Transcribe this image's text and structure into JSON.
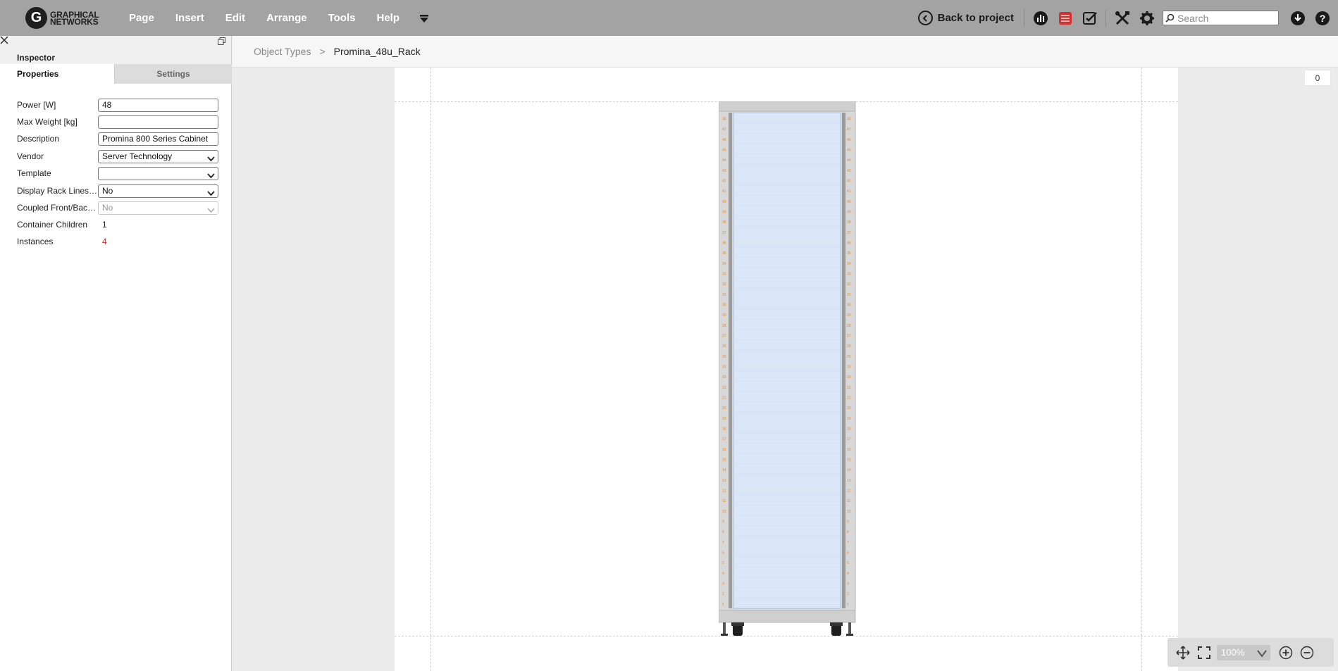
{
  "app": {
    "logo_mark": "G",
    "logo_line1": "GRAPHICAL",
    "logo_line2": "NETWORKS"
  },
  "menu": {
    "items": [
      "Page",
      "Insert",
      "Edit",
      "Arrange",
      "Tools",
      "Help"
    ]
  },
  "toolbar": {
    "back_label": "Back to project",
    "search_placeholder": "Search",
    "icons": [
      "dashboard-icon",
      "report-icon",
      "checklist-icon",
      "tools-icon",
      "settings-icon",
      "download-icon",
      "help-icon"
    ],
    "report_color": "#d32f2f"
  },
  "inspector": {
    "title": "Inspector",
    "tabs": {
      "properties": "Properties",
      "settings": "Settings"
    },
    "fields": {
      "power": {
        "label": "Power [W]",
        "value": "48"
      },
      "max_weight": {
        "label": "Max Weight [kg]",
        "value": ""
      },
      "description": {
        "label": "Description",
        "value": "Promina 800 Series Cabinet"
      },
      "vendor": {
        "label": "Vendor",
        "value": "Server Technology"
      },
      "template": {
        "label": "Template",
        "value": ""
      },
      "display_rack_lines": {
        "label": "Display Rack Lines i...",
        "value": "No"
      },
      "coupled": {
        "label": "Coupled Front/Back ...",
        "value": "No"
      },
      "container_children": {
        "label": "Container Children",
        "value": "1"
      },
      "instances": {
        "label": "Instances",
        "value": "4"
      }
    }
  },
  "breadcrumb": {
    "root": "Object Types",
    "separator": ">",
    "current": "Promina_48u_Rack"
  },
  "canvas": {
    "counter": "0",
    "zoom": "100%",
    "rack": {
      "units": 48,
      "frame_color": "#d8d8d8",
      "interior_color": "#dbe6f7",
      "label_color": "#e8892b"
    }
  }
}
